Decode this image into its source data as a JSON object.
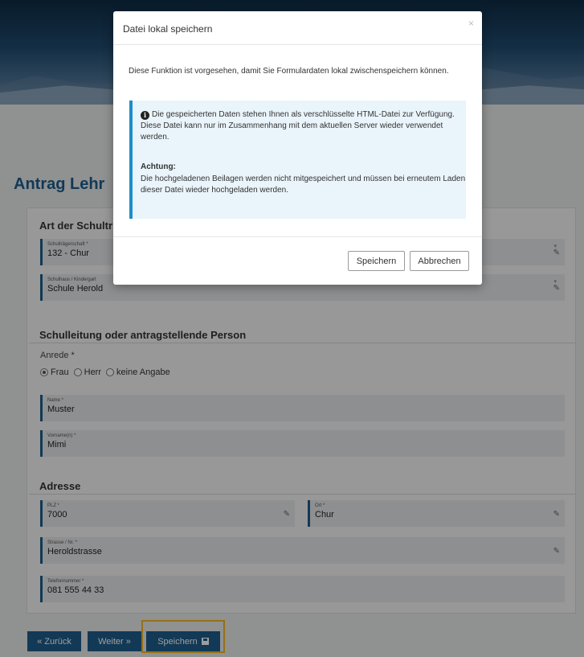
{
  "page": {
    "title": "Antrag Lehr",
    "sections": {
      "schultraeger": "Art der Schultr",
      "schulleitung": "Schulleitung oder antragstellende Person",
      "adresse": "Adresse"
    },
    "fields": {
      "schultraegerschaft": {
        "label": "Schulträgerschaft *",
        "value": "132 - Chur"
      },
      "schulhaus": {
        "label": "Schulhaus / Kindergart",
        "value": "Schule Herold"
      },
      "name": {
        "label": "Name *",
        "value": "Muster"
      },
      "vorname": {
        "label": "Vorname(n) *",
        "value": "Mimi"
      },
      "plz": {
        "label": "PLZ *",
        "value": "7000"
      },
      "ort": {
        "label": "Ort *",
        "value": "Chur"
      },
      "strasse": {
        "label": "Strasse / Nr. *",
        "value": "Heroldstrasse"
      },
      "telefon": {
        "label": "Telefonnummer *",
        "value": "081 555 44 33"
      }
    },
    "anrede": {
      "label": "Anrede *",
      "options": [
        "Frau",
        "Herr",
        "keine Angabe"
      ],
      "selected": "Frau"
    },
    "buttons": {
      "zurueck": "« Zurück",
      "weiter": "Weiter »",
      "speichern": "Speichern"
    }
  },
  "modal": {
    "title": "Datei lokal speichern",
    "close": "×",
    "intro": "Diese Funktion ist vorgesehen, damit Sie Formulardaten lokal zwischenspeichern können.",
    "info": "Die gespeicherten Daten stehen Ihnen als verschlüsselte HTML-Datei zur Verfügung. Diese Datei kann nur im Zusammenhang mit dem aktuellen Server wieder verwendet werden.",
    "warning_title": "Achtung:",
    "warning_text": "Die hochgeladenen Beilagen werden nicht mitgespeichert und müssen bei erneutem Laden dieser Datei wieder hochgeladen werden.",
    "save_label": "Speichern",
    "cancel_label": "Abbrechen"
  },
  "icons": {
    "info": "info-circle-icon",
    "edit": "pencil-icon",
    "save": "floppy-disk-icon"
  },
  "colors": {
    "primary": "#1d5d8c",
    "highlight": "#f4b324",
    "info_border": "#1d8fc8"
  }
}
